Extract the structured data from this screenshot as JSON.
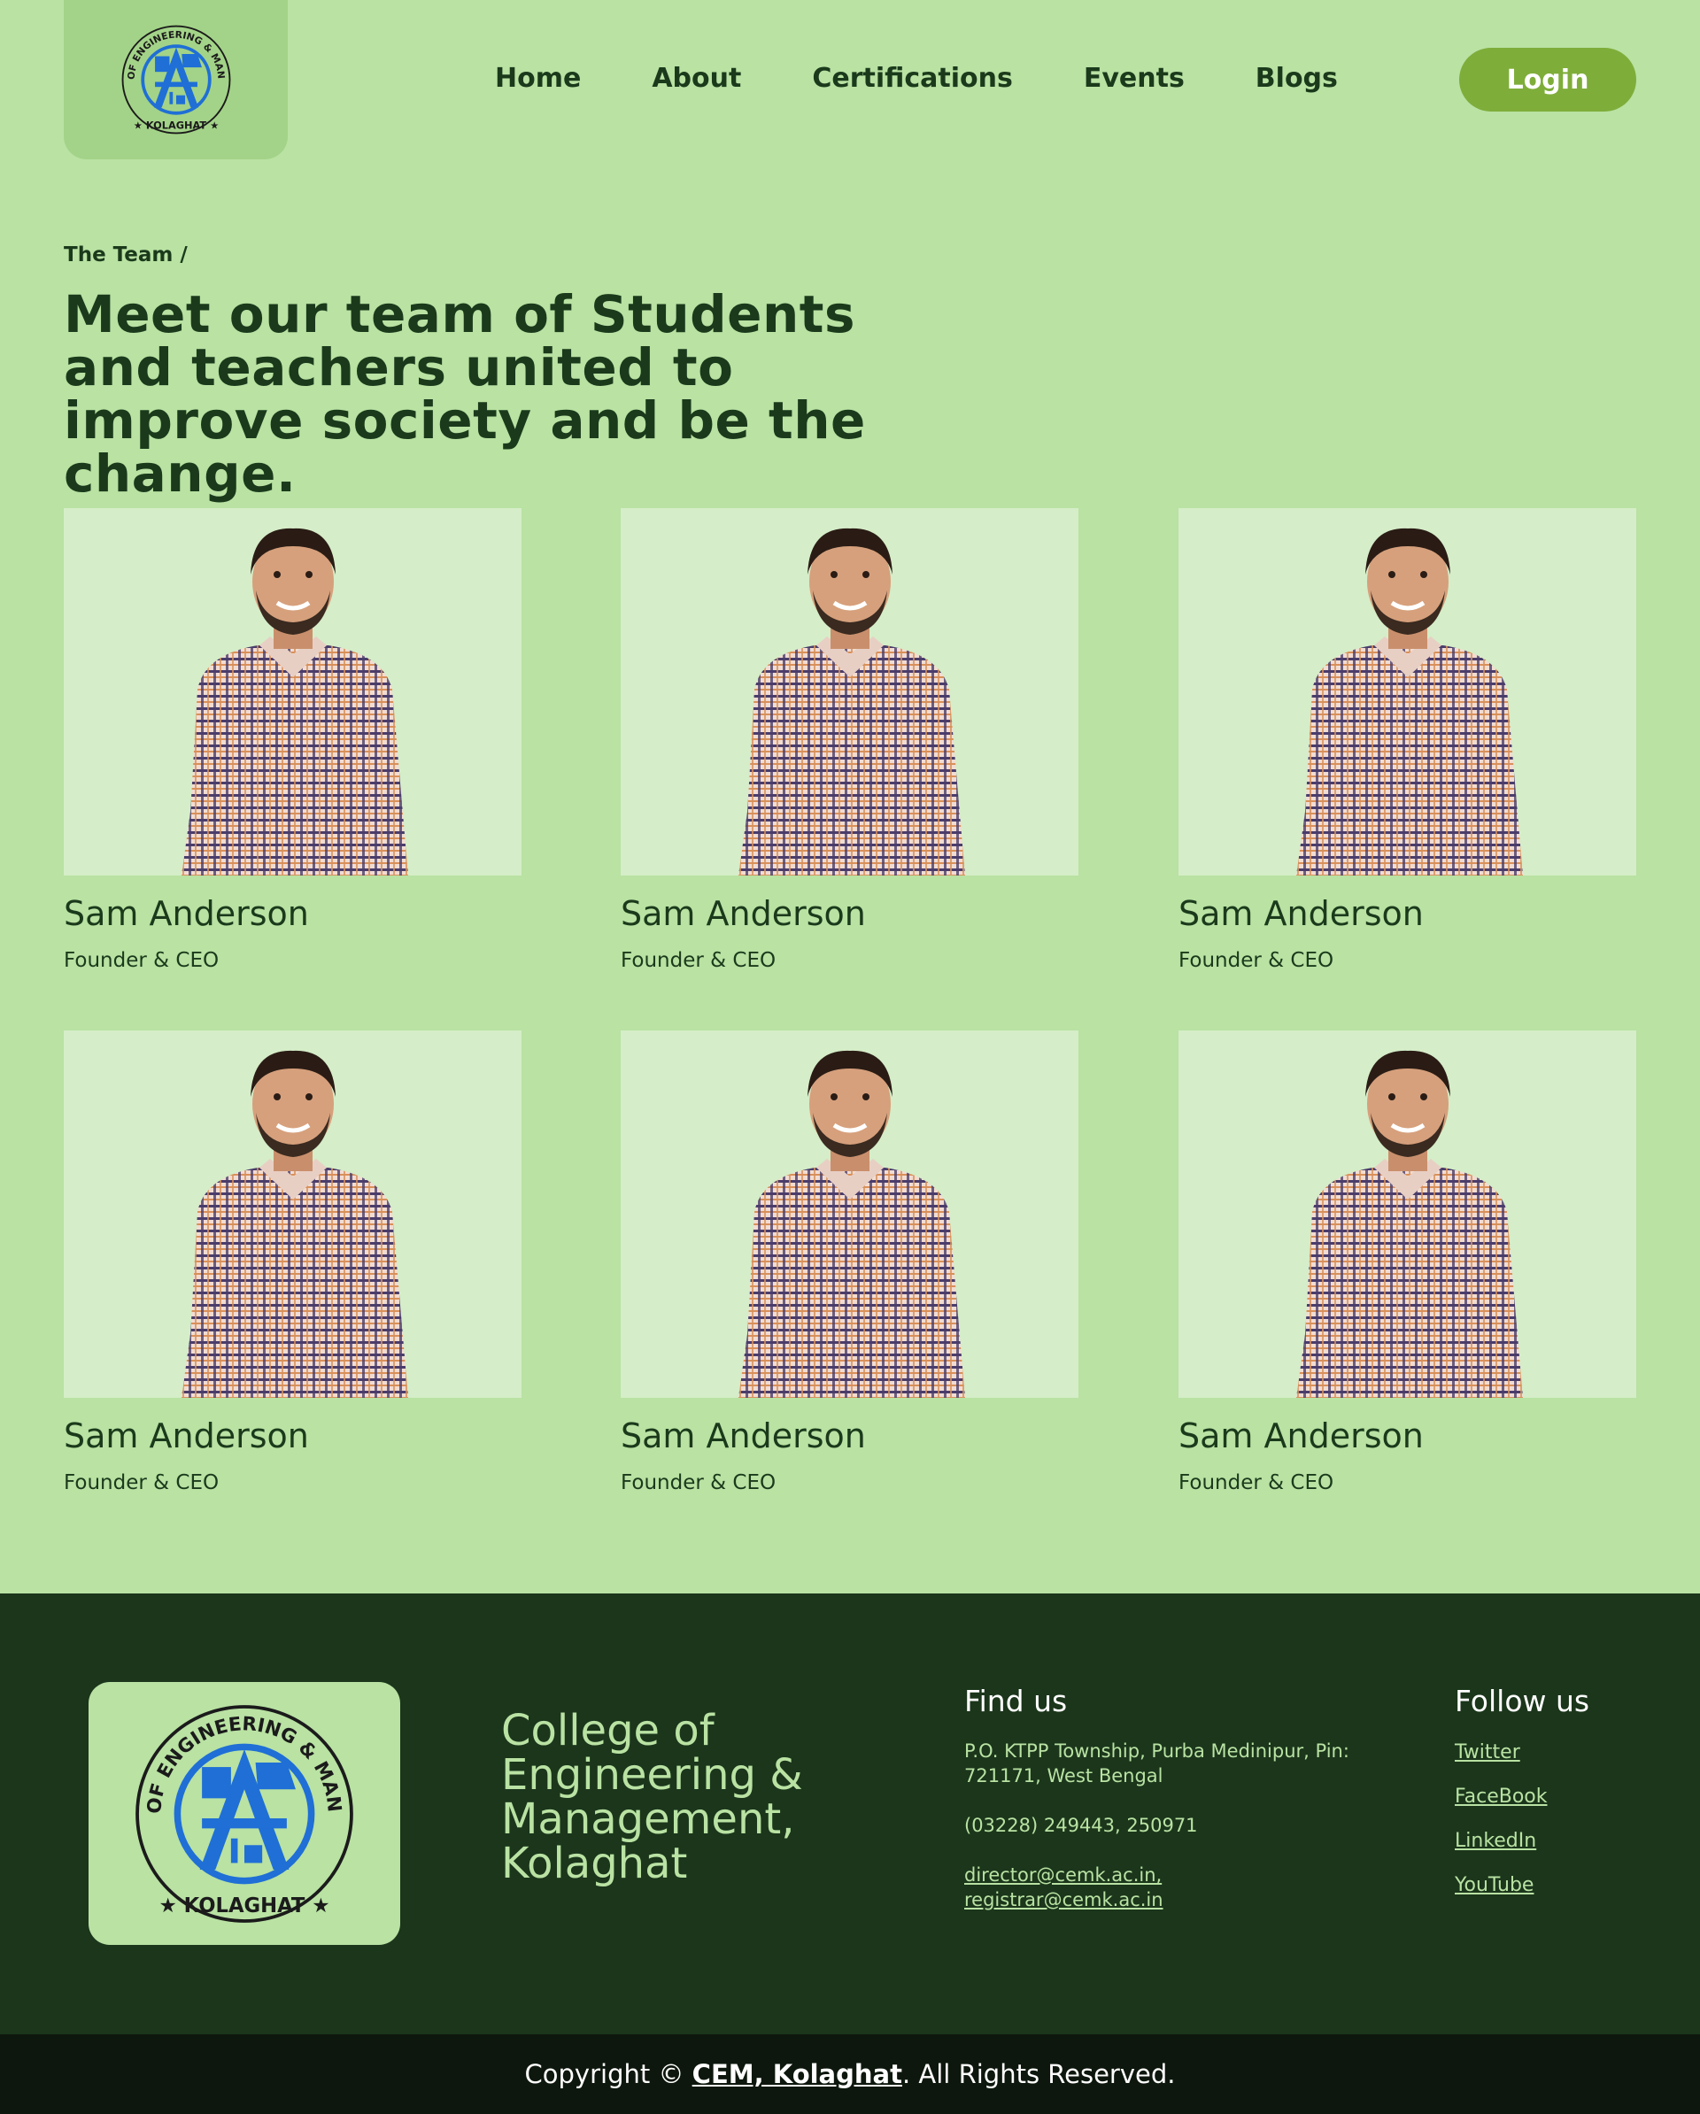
{
  "header": {
    "logo_text_top": "COLLEGE OF ENGINEERING & MANAGEMENT",
    "logo_text_bottom": "KOLAGHAT",
    "nav": [
      "Home",
      "About",
      "Certifications",
      "Events",
      "Blogs"
    ],
    "login_label": "Login"
  },
  "intro": {
    "breadcrumb": "The Team /",
    "heading": "Meet our team of Students and teachers united to improve society and be the change."
  },
  "team": [
    {
      "name": "Sam Anderson",
      "role": "Founder & CEO"
    },
    {
      "name": "Sam Anderson",
      "role": "Founder & CEO"
    },
    {
      "name": "Sam Anderson",
      "role": "Founder & CEO"
    },
    {
      "name": "Sam Anderson",
      "role": "Founder & CEO"
    },
    {
      "name": "Sam Anderson",
      "role": "Founder & CEO"
    },
    {
      "name": "Sam Anderson",
      "role": "Founder & CEO"
    }
  ],
  "footer": {
    "college_name": "College of Engineering & Management, Kolaghat",
    "find_us": {
      "heading": "Find us",
      "address": "P.O. KTPP Township, Purba Medinipur, Pin: 721171, West Bengal",
      "phone": "(03228) 249443, 250971",
      "email_1": "director@cemk.ac.in,",
      "email_2": "registrar@cemk.ac.in"
    },
    "follow_us": {
      "heading": "Follow us",
      "links": [
        "Twitter",
        "FaceBook",
        "LinkedIn",
        "YouTube"
      ]
    }
  },
  "copyright": {
    "prefix": "Copyright © ",
    "org": "CEM, Kolaghat",
    "suffix": ". All Rights Reserved."
  },
  "colors": {
    "page_bg": "#b9e2a3",
    "logo_box": "#a3d388",
    "accent_button": "#7fad3a",
    "dark_text": "#1b3a1b",
    "footer_bg": "#1b361b",
    "copyright_bg": "#0d170d",
    "photo_bg": "#d5edc8",
    "logo_blue": "#1f6fd6"
  }
}
